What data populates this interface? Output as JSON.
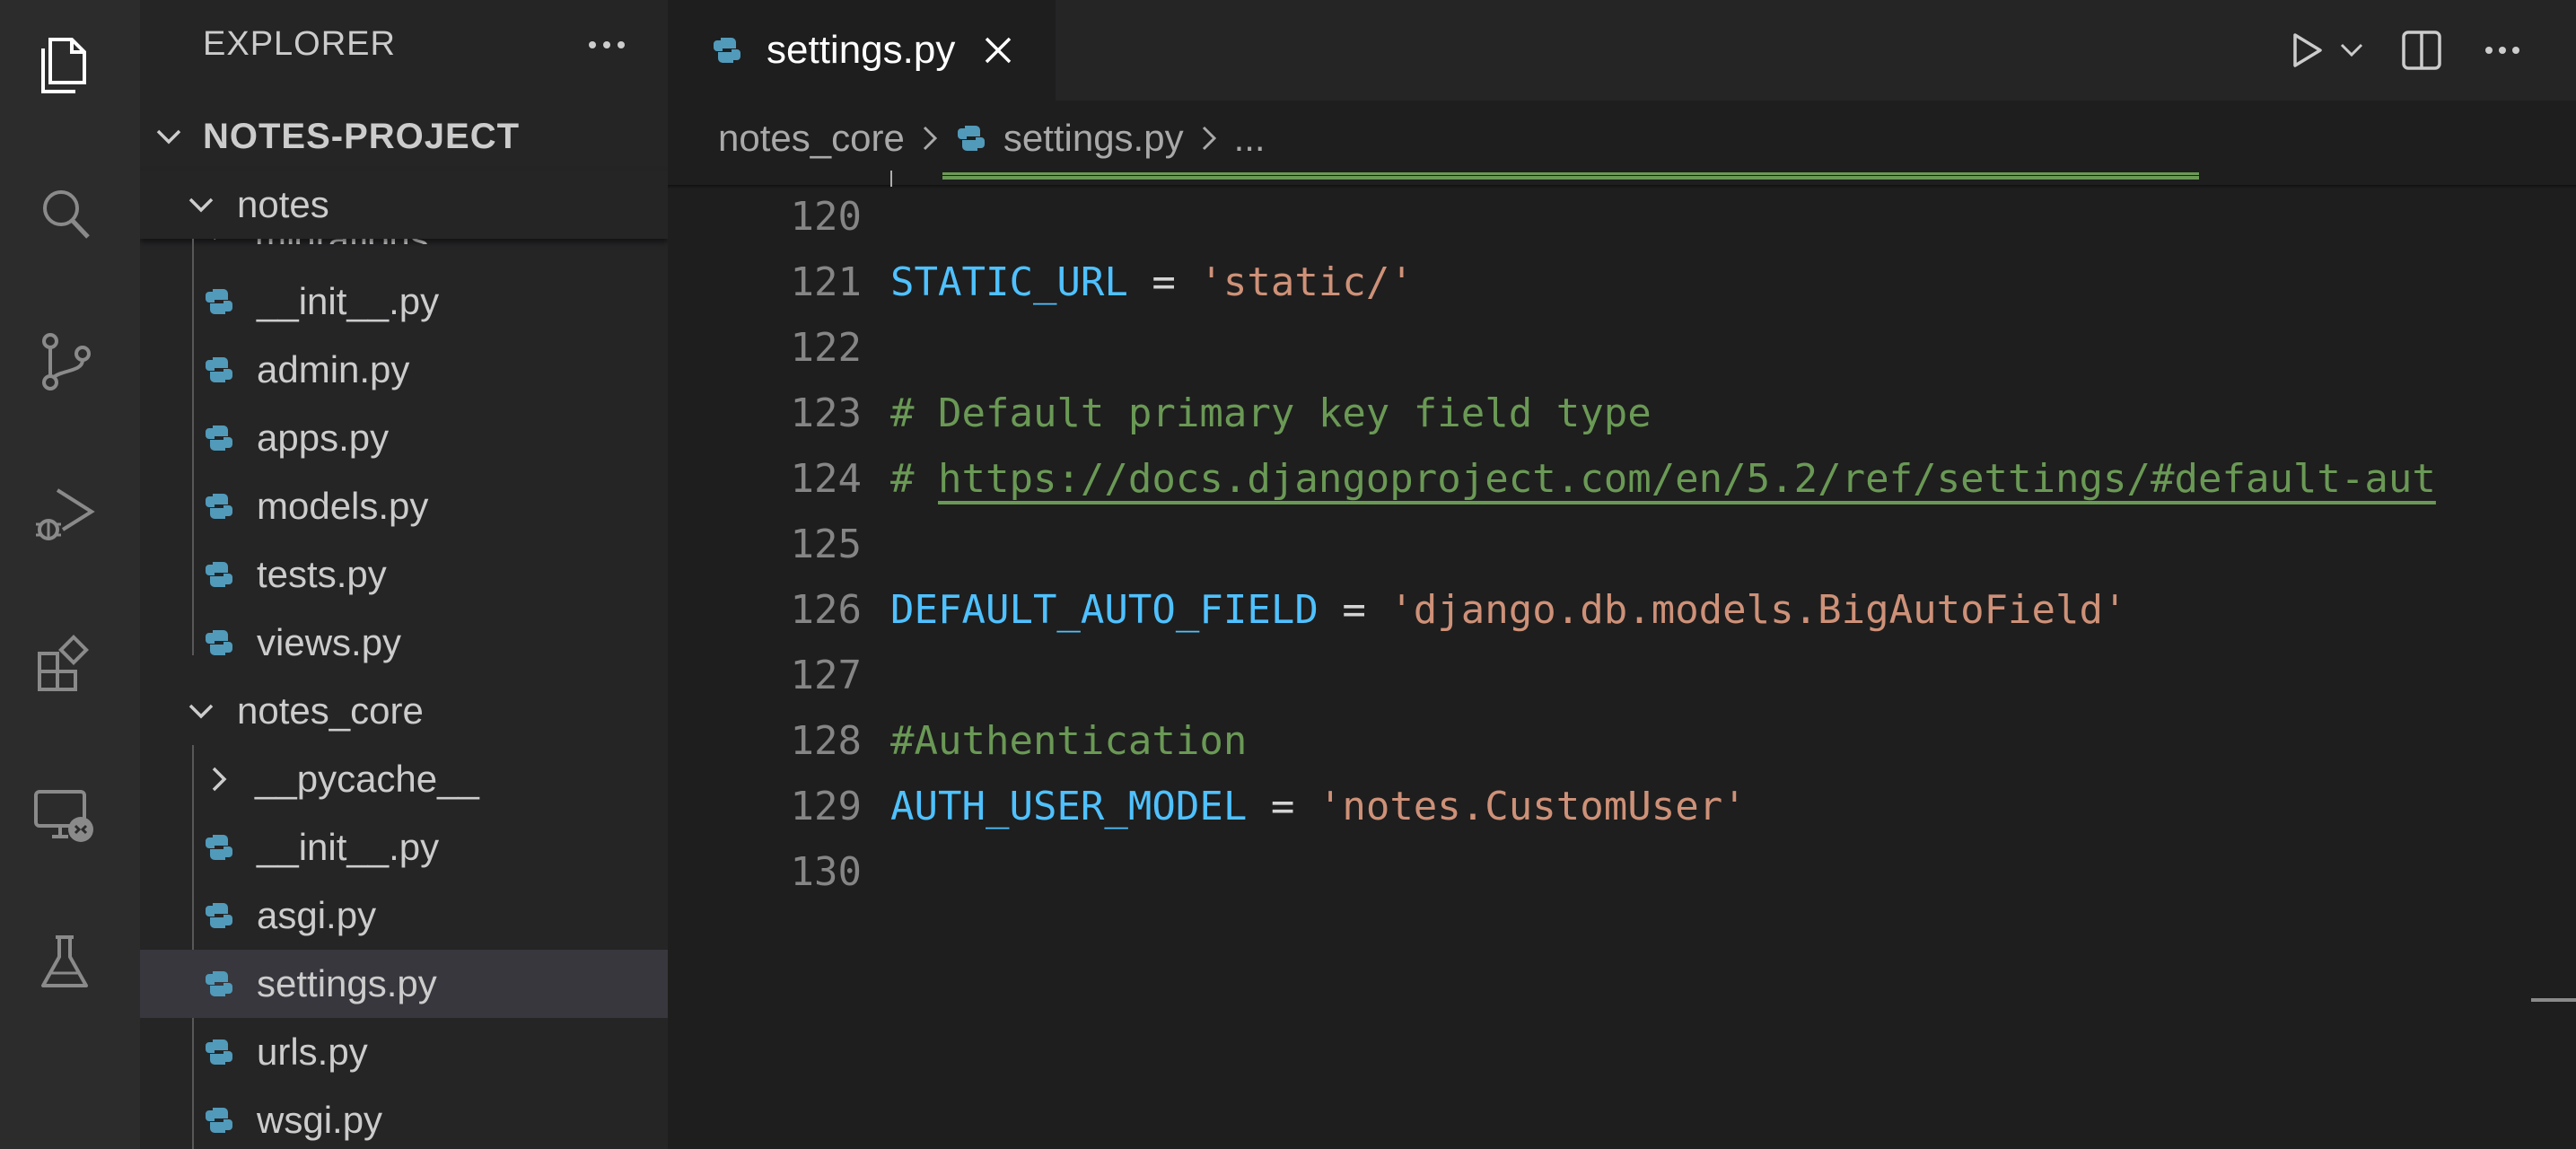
{
  "activity_bar": {
    "icons": [
      "files-icon",
      "search-icon",
      "source-control-icon",
      "run-debug-icon",
      "extensions-icon",
      "remote-explorer-icon",
      "testing-icon"
    ]
  },
  "explorer": {
    "title": "EXPLORER",
    "project": "NOTES-PROJECT",
    "folder_notes": "notes",
    "folder_migrations": "migrations",
    "notes_files": [
      "__init__.py",
      "admin.py",
      "apps.py",
      "models.py",
      "tests.py",
      "views.py"
    ],
    "folder_notes_core": "notes_core",
    "folder_pycache": "__pycache__",
    "core_files": [
      "__init__.py",
      "asgi.py",
      "settings.py",
      "urls.py",
      "wsgi.py"
    ],
    "selected_file": "settings.py"
  },
  "editor": {
    "tab_title": "settings.py",
    "breadcrumb": {
      "folder": "notes_core",
      "file": "settings.py",
      "tail": "..."
    },
    "line_numbers": [
      "120",
      "121",
      "122",
      "123",
      "124",
      "125",
      "126",
      "127",
      "128",
      "129",
      "130"
    ],
    "code": {
      "l121_name": "STATIC_URL",
      "l121_op": " = ",
      "l121_val": "'static/'",
      "l123_comment": "# Default primary key field type",
      "l124_hash": "# ",
      "l124_url": "https://docs.djangoproject.com/en/5.2/ref/settings/#default-aut",
      "l126_name": "DEFAULT_AUTO_FIELD",
      "l126_op": " = ",
      "l126_val": "'django.db.models.BigAutoField'",
      "l128_comment": "#Authentication",
      "l129_name": "AUTH_USER_MODEL",
      "l129_op": " = ",
      "l129_val": "'notes.CustomUser'"
    }
  },
  "colors": {
    "variable": "#4fc1ff",
    "string": "#ce9178",
    "comment": "#6a9955",
    "python_icon": "#519aba"
  }
}
